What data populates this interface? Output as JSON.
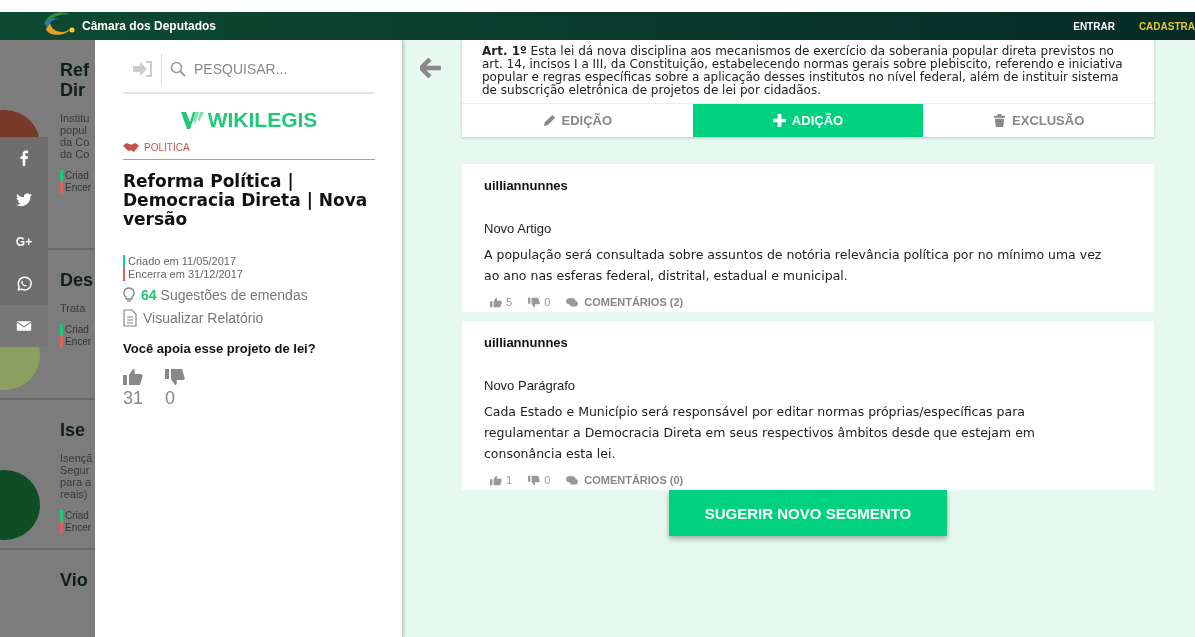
{
  "header": {
    "title": "Câmara dos Deputados",
    "links": [
      {
        "label": "ENTRAR",
        "kind": "login"
      },
      {
        "label": "CADASTRA",
        "kind": "signup"
      }
    ]
  },
  "background_list": [
    {
      "title_lines": [
        "Ref",
        "Dir"
      ],
      "desc_lines": [
        "Institu",
        "popul",
        "da Co",
        "da Co"
      ],
      "created": "Criad",
      "closes": "Encer",
      "color": "#7a3a2a"
    },
    {
      "title_lines": [
        "Des"
      ],
      "desc_lines": [
        "Trata"
      ],
      "created": "Criad",
      "closes": "Encer",
      "color": "#8aa060"
    },
    {
      "title_lines": [
        "Ise"
      ],
      "desc_lines": [
        "Isençã",
        "Segur",
        "para a",
        "reais)"
      ],
      "created": "Criad",
      "closes": "Encer",
      "color": "#0f4d25"
    },
    {
      "title_lines": [
        "Vio"
      ]
    }
  ],
  "share_bar": [
    {
      "kind": "facebook"
    },
    {
      "kind": "twitter"
    },
    {
      "kind": "gplus",
      "label": "G+"
    },
    {
      "kind": "whatsapp"
    },
    {
      "kind": "mail"
    }
  ],
  "sidebar": {
    "search": {
      "placeholder": "PESQUISAR..."
    },
    "logo": "WIKILEGIS",
    "category": "POLITICA",
    "title": "Reforma Política | Democracia Direta | Nova versão",
    "created": "Criado em 11/05/2017",
    "closes": "Encerra em 31/12/2017",
    "suggestions_count": "64",
    "suggestions_label": "Sugestões de emendas",
    "report_link": "Visualizar Relatório",
    "question": "Você apoia esse projeto de lei?",
    "votes_up": "31",
    "votes_down": "0"
  },
  "article": {
    "text": "**Art. 1º** Esta lei dá nova disciplina aos mecanismos de exercício da soberania popular direta previstos no art. 14, incisos I a III, da Constituição, estabelecendo normas gerais sobre plebiscito, referendo e iniciativa popular e regras específicas sobre a aplicação desses institutos no nível federal, além de instituir sistema de subscrição eletrônica de projetos de lei por cidadãos.",
    "tabs": [
      {
        "label": "EDIÇÃO",
        "kind": "edit",
        "selected": false
      },
      {
        "label": "ADIÇÃO",
        "kind": "add",
        "selected": true
      },
      {
        "label": "EXCLUSÃO",
        "kind": "delete",
        "selected": false
      }
    ]
  },
  "suggestions": [
    {
      "author": "uilliannunnes",
      "type": "Novo Artigo",
      "text": "A população será consultada sobre assuntos de notória relevância política por no mínimo uma vez ao ano nas esferas federal, distrital, estadual e municipal.",
      "likes": "5",
      "dislikes": "0",
      "comments": "COMENTÁRIOS (2)"
    },
    {
      "author": "uilliannunnes",
      "type": "Novo Parágrafo",
      "text": "Cada Estado e Município será responsável por editar normas próprias/específicas para regulamentar a Democracia Direta em seus respectivos âmbitos desde que estejam em consonância esta lei.",
      "likes": "1",
      "dislikes": "0",
      "comments": "COMENTÁRIOS (0)"
    }
  ],
  "suggest_button": "SUGERIR NOVO SEGMENTO"
}
